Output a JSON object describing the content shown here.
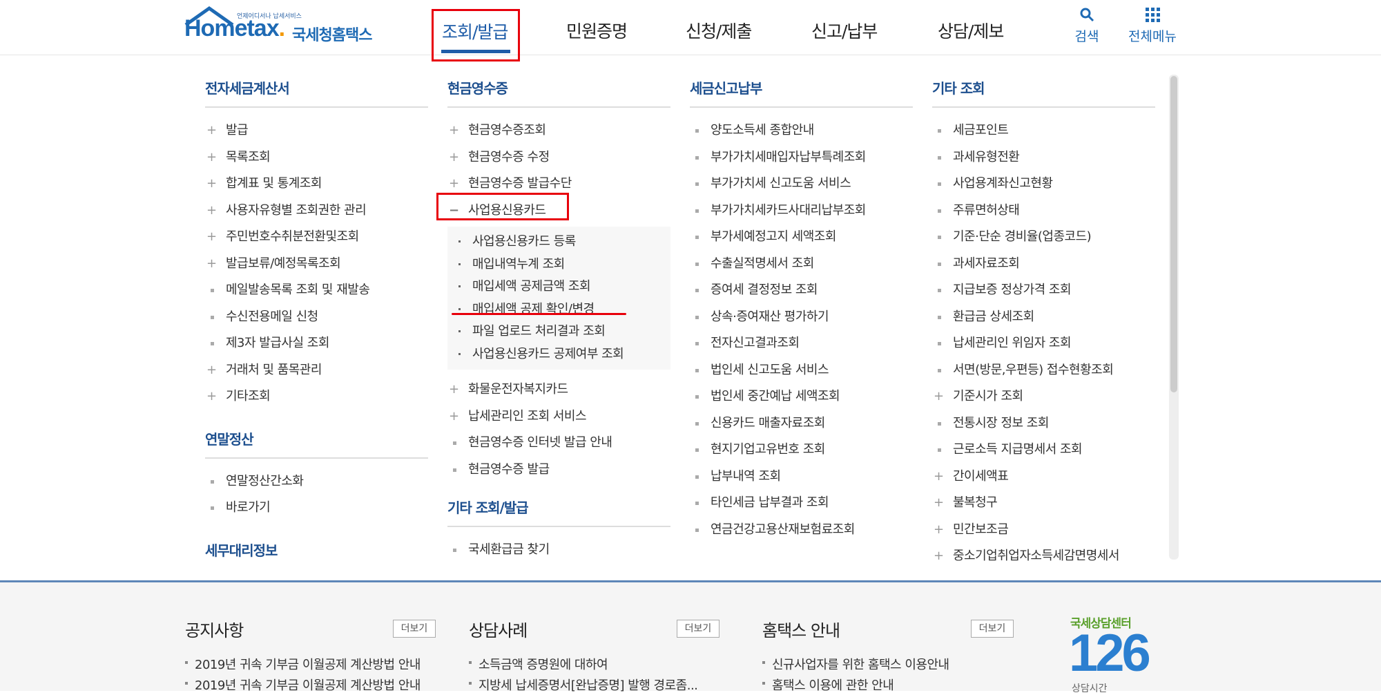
{
  "header": {
    "logo_tagline": "언제어디서나 납세서비스",
    "logo_brand_home": "Hom",
    "logo_brand_tax": "etax",
    "logo_dot": ".",
    "logo_kr": "국세청홈택스",
    "nav": [
      {
        "label": "조회/발급",
        "active": true
      },
      {
        "label": "민원증명"
      },
      {
        "label": "신청/제출"
      },
      {
        "label": "신고/납부"
      },
      {
        "label": "상담/제보"
      }
    ],
    "search_label": "검색",
    "allmenu_label": "전체메뉴"
  },
  "columns": {
    "einvoice": {
      "title": "전자세금계산서",
      "items": [
        {
          "label": "발급",
          "type": "plus"
        },
        {
          "label": "목록조회",
          "type": "plus"
        },
        {
          "label": "합계표 및 통계조회",
          "type": "plus"
        },
        {
          "label": "사용자유형별 조회권한 관리",
          "type": "plus"
        },
        {
          "label": "주민번호수취분전환및조회",
          "type": "plus"
        },
        {
          "label": "발급보류/예정목록조회",
          "type": "plus"
        },
        {
          "label": "메일발송목록 조회 및 재발송",
          "type": "square"
        },
        {
          "label": "수신전용메일 신청",
          "type": "square"
        },
        {
          "label": "제3자 발급사실 조회",
          "type": "square"
        },
        {
          "label": "거래처 및 품목관리",
          "type": "plus"
        },
        {
          "label": "기타조회",
          "type": "plus"
        }
      ]
    },
    "yearend": {
      "title": "연말정산",
      "items": [
        {
          "label": "연말정산간소화",
          "type": "square"
        },
        {
          "label": "바로가기",
          "type": "square"
        }
      ]
    },
    "taxagent": {
      "title": "세무대리정보"
    },
    "cashreceipt": {
      "title": "현금영수증",
      "items_top": [
        {
          "label": "현금영수증조회",
          "type": "plus"
        },
        {
          "label": "현금영수증 수정",
          "type": "plus"
        },
        {
          "label": "현금영수증 발급수단",
          "type": "plus"
        }
      ],
      "expanded_label": "사업용신용카드",
      "expanded_sign": "−",
      "sub_items": [
        "사업용신용카드 등록",
        "매입내역누계 조회",
        "매입세액 공제금액 조회",
        "매입세액 공제 확인/변경",
        "파일 업로드 처리결과 조회",
        "사업용신용카드 공제여부 조회"
      ],
      "items_bottom": [
        {
          "label": "화물운전자복지카드",
          "type": "plus"
        },
        {
          "label": "납세관리인 조회 서비스",
          "type": "plus"
        },
        {
          "label": "현금영수증 인터넷 발급 안내",
          "type": "square"
        },
        {
          "label": "현금영수증 발급",
          "type": "square"
        }
      ]
    },
    "otherissue": {
      "title": "기타 조회/발급",
      "items": [
        {
          "label": "국세환급금 찾기",
          "type": "square"
        }
      ]
    },
    "taxreturn": {
      "title": "세금신고납부",
      "items": [
        {
          "label": "양도소득세 종합안내",
          "type": "square"
        },
        {
          "label": "부가가치세매입자납부특례조회",
          "type": "square"
        },
        {
          "label": "부가가치세 신고도움 서비스",
          "type": "square"
        },
        {
          "label": "부가가치세카드사대리납부조회",
          "type": "square"
        },
        {
          "label": "부가세예정고지 세액조회",
          "type": "square"
        },
        {
          "label": "수출실적명세서 조회",
          "type": "square"
        },
        {
          "label": "증여세 결정정보 조회",
          "type": "square"
        },
        {
          "label": "상속·증여재산 평가하기",
          "type": "square"
        },
        {
          "label": "전자신고결과조회",
          "type": "square"
        },
        {
          "label": "법인세 신고도움 서비스",
          "type": "square"
        },
        {
          "label": "법인세 중간예납 세액조회",
          "type": "square"
        },
        {
          "label": "신용카드 매출자료조회",
          "type": "square"
        },
        {
          "label": "현지기업고유번호 조회",
          "type": "square"
        },
        {
          "label": "납부내역 조회",
          "type": "square"
        },
        {
          "label": "타인세금 납부결과 조회",
          "type": "square"
        },
        {
          "label": "연금건강고용산재보험료조회",
          "type": "square"
        }
      ]
    },
    "otherinquiry": {
      "title": "기타 조회",
      "items": [
        {
          "label": "세금포인트",
          "type": "square"
        },
        {
          "label": "과세유형전환",
          "type": "square"
        },
        {
          "label": "사업용계좌신고현황",
          "type": "square"
        },
        {
          "label": "주류면허상태",
          "type": "square"
        },
        {
          "label": "기준·단순 경비율(업종코드)",
          "type": "square"
        },
        {
          "label": "과세자료조회",
          "type": "square"
        },
        {
          "label": "지급보증 정상가격 조회",
          "type": "square"
        },
        {
          "label": "환급금 상세조회",
          "type": "square"
        },
        {
          "label": "납세관리인 위임자 조회",
          "type": "square"
        },
        {
          "label": "서면(방문,우편등) 접수현황조회",
          "type": "square"
        },
        {
          "label": "기준시가 조회",
          "type": "plus"
        },
        {
          "label": "전통시장 정보 조회",
          "type": "square"
        },
        {
          "label": "근로소득 지급명세서 조회",
          "type": "square"
        },
        {
          "label": "간이세액표",
          "type": "plus"
        },
        {
          "label": "불복청구",
          "type": "plus"
        },
        {
          "label": "민간보조금",
          "type": "plus"
        },
        {
          "label": "중소기업취업자소득세감면명세서",
          "type": "plus"
        }
      ]
    }
  },
  "footer": {
    "notice_title": "공지사항",
    "notice_more": "더보기",
    "notice_items": [
      "2019년 귀속 기부금 이월공제 계산방법 안내",
      "2019년 귀속 기부금 이월공제 계산방법 안내"
    ],
    "case_title": "상담사례",
    "case_more": "더보기",
    "case_items": [
      "소득금액 증명원에 대하여",
      "지방세 납세증명서[완납증명] 발행 경로좀..."
    ],
    "guide_title": "홈택스 안내",
    "guide_more": "더보기",
    "guide_items": [
      "신규사업자를 위한 홈택스 이용안내",
      "홈택스 이용에 관한 안내"
    ],
    "center_label": "국세상담센터",
    "center_number": "126",
    "center_hours": "상담시간"
  },
  "colors": {
    "brand_blue": "#1e6ab4",
    "title_blue": "#1d4f8e",
    "highlight_red": "#e8000b",
    "logo_orange": "#f39800"
  }
}
